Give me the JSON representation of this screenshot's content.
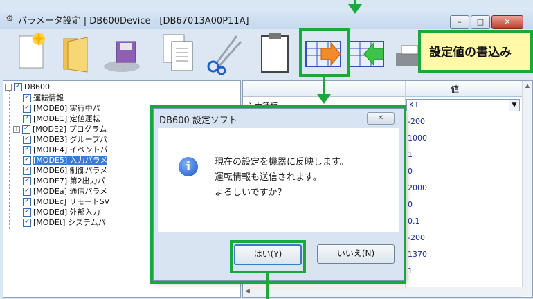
{
  "window": {
    "title": "パラメータ設定 | DB600Device - [DB67013A00P11A]",
    "min_label": "–",
    "max_label": "□",
    "close_label": "✕"
  },
  "toolbar": {
    "icons": [
      "new-icon",
      "open-folder-icon",
      "save-icon",
      "copy-document-icon",
      "cut-icon",
      "paste-icon",
      "write-to-device-icon",
      "read-from-device-icon",
      "print-icon"
    ]
  },
  "tree": {
    "root": "DB600",
    "items": [
      "運転情報",
      "[MODE0] 実行中パ",
      "[MODE1] 定値運転",
      "[MODE2] プログラム",
      "[MODE3] グループパ",
      "[MODE4] イベントパ",
      "[MODE5] 入力パラメ",
      "[MODE6] 制御パラメ",
      "[MODE7] 第2出力パ",
      "[MODEa] 通信パラメ",
      "[MODEc] リモートSV",
      "[MODEd] 外部入力",
      "[MODEt] システムパ"
    ],
    "selected_index": 6
  },
  "grid": {
    "header_value": "値",
    "first_label": "入力種類",
    "combo_value": "K1",
    "values": [
      "-200",
      "1000",
      "1",
      "0",
      "2000",
      "0",
      "0.1",
      "-200",
      "1370",
      "1"
    ]
  },
  "dialog": {
    "title": "DB600 設定ソフト",
    "close_label": "✕",
    "line1": "現在の設定を機器に反映します。",
    "line2": "運転情報も送信されます。",
    "line3": "よろしいですか？",
    "yes_label": "はい(Y)",
    "no_label": "いいえ(N)"
  },
  "callout": {
    "text": "設定値の書込み"
  },
  "colors": {
    "annotation_green": "#1aa83c",
    "callout_bg": "#fff9a8",
    "selection_blue": "#3a7bd5"
  }
}
